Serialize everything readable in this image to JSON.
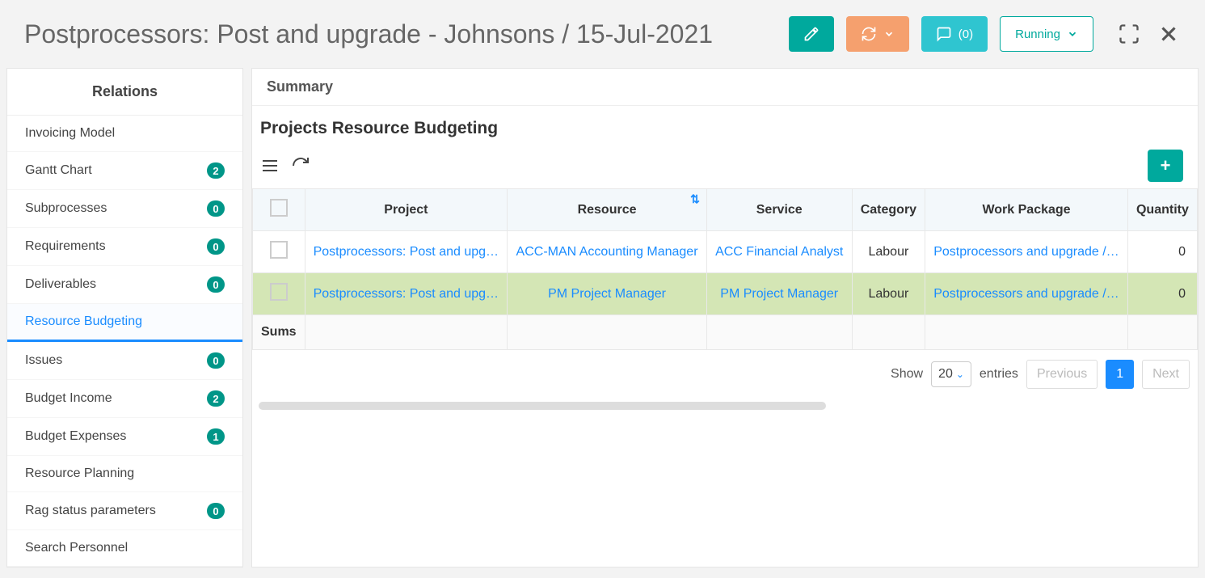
{
  "header": {
    "title": "Postprocessors: Post and upgrade - Johnsons / 15-Jul-2021",
    "comments_label": "(0)",
    "status_label": "Running"
  },
  "sidebar": {
    "header": "Relations",
    "items": [
      {
        "label": "Invoicing Model",
        "badge": null,
        "active": false
      },
      {
        "label": "Gantt Chart",
        "badge": "2",
        "active": false
      },
      {
        "label": "Subprocesses",
        "badge": "0",
        "active": false
      },
      {
        "label": "Requirements",
        "badge": "0",
        "active": false
      },
      {
        "label": "Deliverables",
        "badge": "0",
        "active": false
      },
      {
        "label": "Resource Budgeting",
        "badge": null,
        "active": true
      },
      {
        "label": "Issues",
        "badge": "0",
        "active": false
      },
      {
        "label": "Budget Income",
        "badge": "2",
        "active": false
      },
      {
        "label": "Budget Expenses",
        "badge": "1",
        "active": false
      },
      {
        "label": "Resource Planning",
        "badge": null,
        "active": false
      },
      {
        "label": "Rag status parameters",
        "badge": "0",
        "active": false
      },
      {
        "label": "Search Personnel",
        "badge": null,
        "active": false
      }
    ]
  },
  "main": {
    "summary_label": "Summary",
    "section_title": "Projects Resource Budgeting",
    "columns": [
      "Project",
      "Resource",
      "Service",
      "Category",
      "Work Package",
      "Quantity"
    ],
    "rows": [
      {
        "project": "Postprocessors: Post and upgr…",
        "resource": "ACC-MAN Accounting Manager",
        "service": "ACC Financial Analyst",
        "category": "Labour",
        "work_package": "Postprocessors and upgrade / …",
        "quantity": "0",
        "highlight": false
      },
      {
        "project": "Postprocessors: Post and upgr…",
        "resource": "PM Project Manager",
        "service": "PM Project Manager",
        "category": "Labour",
        "work_package": "Postprocessors and upgrade / …",
        "quantity": "0",
        "highlight": true
      }
    ],
    "sums_label": "Sums",
    "pagination": {
      "show_label": "Show",
      "page_size": "20",
      "entries_label": "entries",
      "prev": "Previous",
      "current": "1",
      "next": "Next"
    }
  }
}
